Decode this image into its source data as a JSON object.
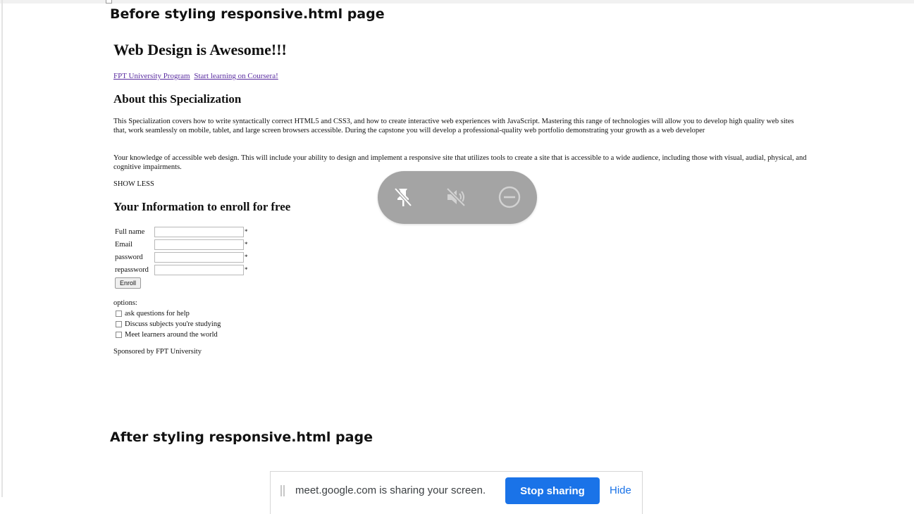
{
  "document": {
    "before_heading": "Before styling responsive.html page",
    "after_heading": "After styling responsive.html page"
  },
  "screenshot_page": {
    "title": "Web Design is Awesome!!!",
    "links": [
      "FPT University Program",
      "Start learning on Coursera!"
    ],
    "about_heading": "About this Specialization",
    "paragraphs": [
      "This Specialization covers how to write syntactically correct HTML5 and CSS3, and how to create interactive web experiences with JavaScript. Mastering this range of technologies will allow you to develop high quality web sites that, work seamlessly on mobile, tablet, and large screen browsers accessible. During the capstone you will develop a professional-quality web portfolio demonstrating your growth as a web developer",
      "Your knowledge of accessible web design. This will include your ability to design and implement a responsive site that utilizes tools to create a site that is accessible to a wide audience, including those with visual, audial, physical, and cognitive impairments."
    ],
    "show_less": "SHOW LESS",
    "enroll_heading": "Your Information to enroll for free",
    "form_fields": [
      {
        "label": "Full name",
        "required_mark": "*"
      },
      {
        "label": "Email",
        "required_mark": "*"
      },
      {
        "label": "password",
        "required_mark": "*"
      },
      {
        "label": "repassword",
        "required_mark": "*"
      }
    ],
    "enroll_button": "Enroll",
    "options_label": "options:",
    "options": [
      {
        "label": "ask questions for help",
        "checked": false
      },
      {
        "label": "Discuss subjects you're studying",
        "checked": false
      },
      {
        "label": "Meet learners around the world",
        "checked": false
      }
    ],
    "sponsor": "Sponsored by FPT University"
  },
  "floating_controls": {
    "icons": [
      "unpin-icon",
      "mute-icon",
      "stop-icon"
    ],
    "background": "#a4a4a4"
  },
  "share_bar": {
    "message": "meet.google.com is sharing your screen.",
    "stop_label": "Stop sharing",
    "hide_label": "Hide",
    "accent": "#1a73e8"
  }
}
